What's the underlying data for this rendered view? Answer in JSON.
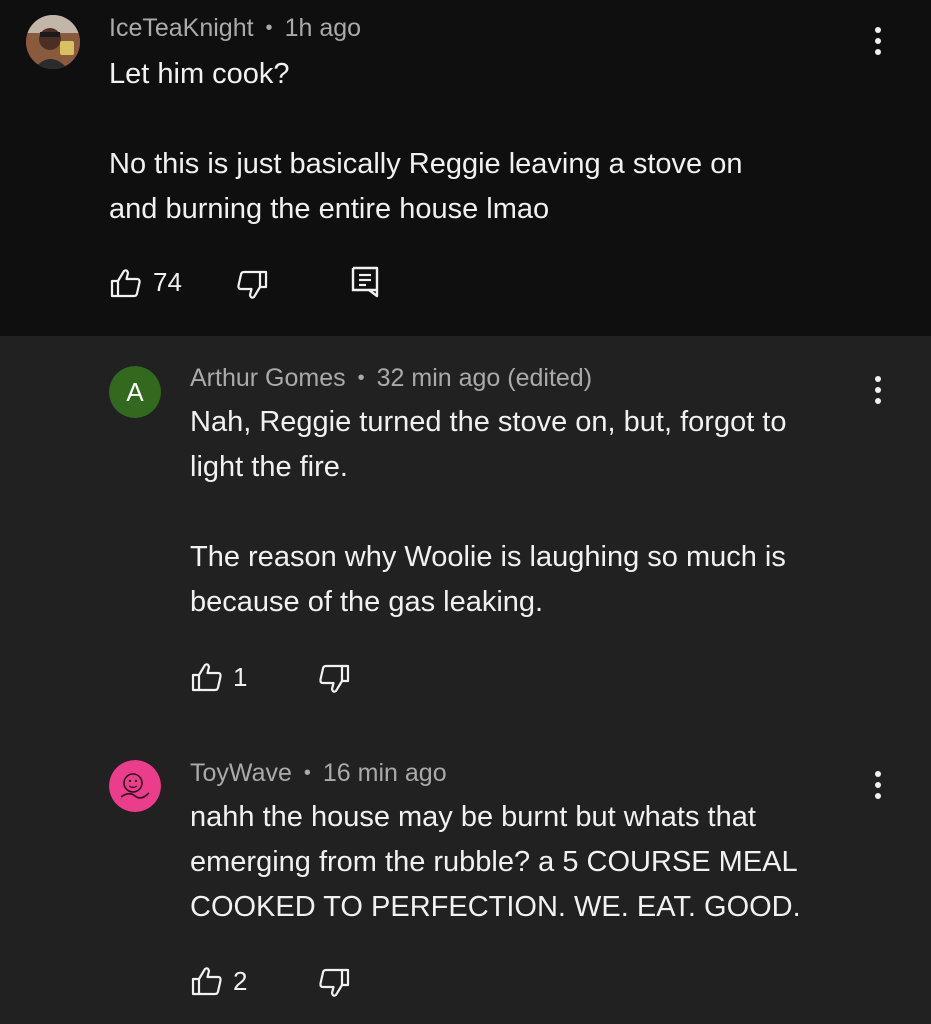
{
  "top_comment": {
    "author": "IceTeaKnight",
    "separator": "•",
    "time": "1h ago",
    "text": "Let him cook?\n\nNo this is just basically Reggie leaving a stove on\nand burning the entire house lmao",
    "likes": "74",
    "avatar_icon": "profile-photo",
    "reply_icon": "reply-icon"
  },
  "replies": [
    {
      "author": "Arthur Gomes",
      "separator": "•",
      "time": "32 min ago (edited)",
      "avatar_letter": "A",
      "avatar_color": "#33691e",
      "text": "Nah, Reggie turned the stove on, but, forgot to\nlight the fire.\n\nThe reason why Woolie is laughing so much is\nbecause of the gas leaking.",
      "likes": "1"
    },
    {
      "author": "ToyWave",
      "separator": "•",
      "time": "16 min ago",
      "avatar_color": "#ec3d8c",
      "avatar_icon": "doodle-face-icon",
      "text": "nahh the house may be burnt but whats that\nemerging from the rubble? a 5 COURSE MEAL\nCOOKED TO PERFECTION. WE. EAT. GOOD.",
      "likes": "2"
    }
  ]
}
